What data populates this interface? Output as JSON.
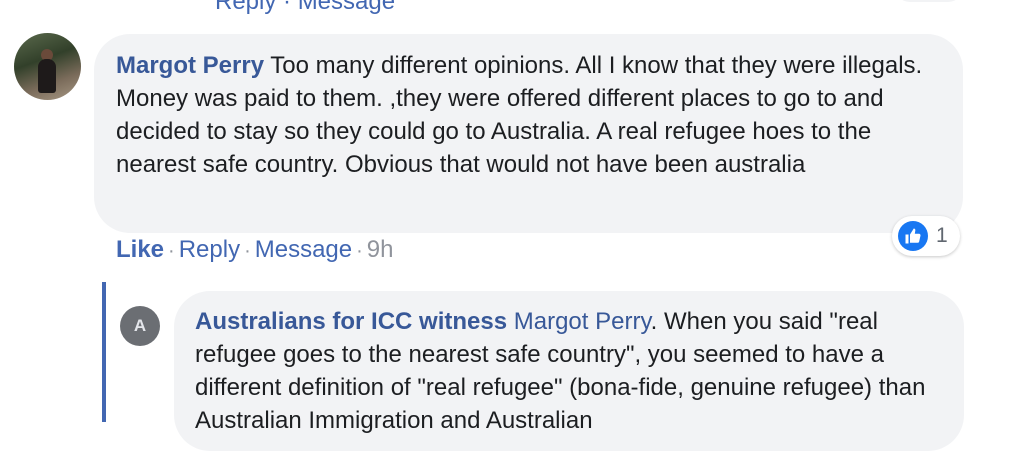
{
  "top_partial_text": "Reply · Message",
  "comment": {
    "author": "Margot Perry",
    "text": "Too many different opinions. All I know that they were illegals. Money was paid to them. ,they were offered different places to go to and decided to stay so they could go to Australia. A real refugee hoes to the nearest safe country. Obvious that would not have been australia",
    "reaction_count": "1",
    "actions": {
      "like": "Like",
      "reply": "Reply",
      "message": "Message",
      "time": "9h",
      "separator": "·"
    }
  },
  "reply": {
    "avatar_letter": "A",
    "author": "Australians for ICC witness",
    "mention": "Margot Perry",
    "text": ". When you said \"real refugee goes to the nearest safe country\", you seemed to have a different definition of \"real refugee\" (bona-fide, genuine refugee) than Australian Immigration and Australian"
  },
  "colors": {
    "link": "#385898",
    "bubble": "#f2f3f5",
    "like_blue": "#1877f2",
    "thread_line": "#4267b2"
  }
}
